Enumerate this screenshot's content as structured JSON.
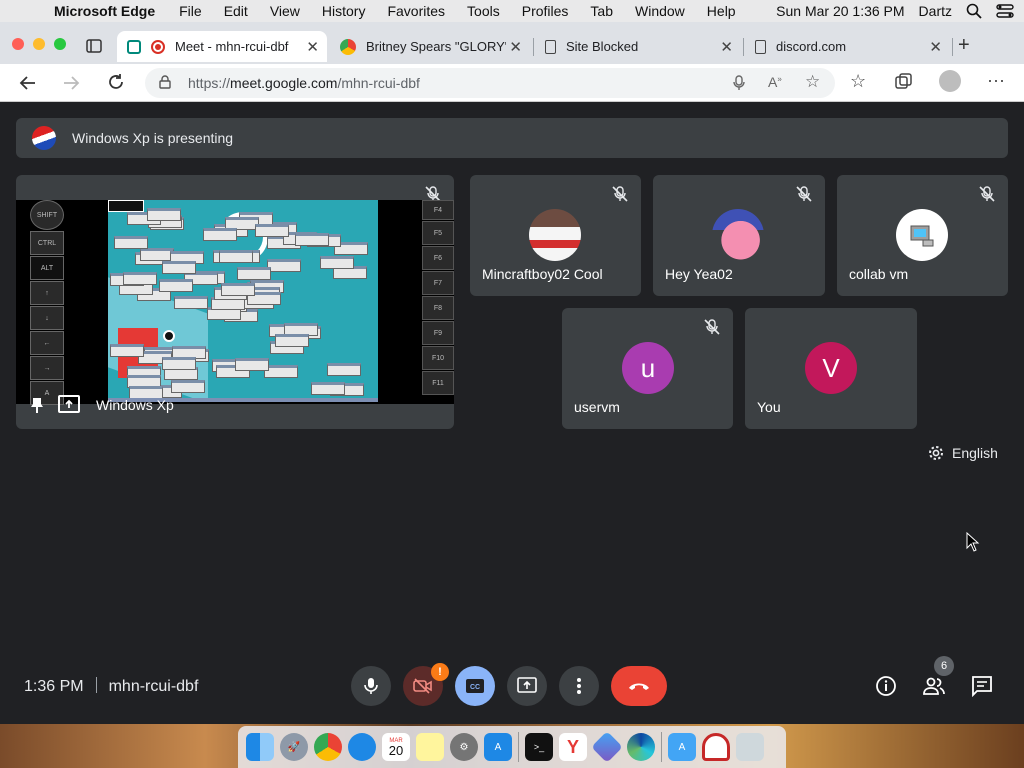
{
  "menubar": {
    "app_name": "Microsoft Edge",
    "menus": [
      "File",
      "Edit",
      "View",
      "History",
      "Favorites",
      "Tools",
      "Profiles",
      "Tab",
      "Window",
      "Help"
    ],
    "datetime": "Sun Mar 20  1:36 PM",
    "user": "Dartz"
  },
  "tabs": [
    {
      "title": "Meet - mhn-rcui-dbf",
      "active": true
    },
    {
      "title": "Britney Spears \"GLORY\"",
      "active": false
    },
    {
      "title": "Site Blocked",
      "active": false
    },
    {
      "title": "discord.com",
      "active": false
    }
  ],
  "address": {
    "url_prefix": "https://",
    "url_host": "meet.google.com",
    "url_path": "/mhn-rcui-dbf"
  },
  "presenting": {
    "text": "Windows Xp is presenting"
  },
  "screen_share": {
    "name": "Windows Xp",
    "left_keys": [
      "SHIFT",
      "CTRL",
      "ALT",
      "↑",
      "↓",
      "←",
      "→",
      "A"
    ],
    "fkeys": [
      "F4",
      "F5",
      "F6",
      "F7",
      "F8",
      "F9",
      "F10",
      "F11"
    ]
  },
  "participants": [
    {
      "name": "Mincraftboy02 Cool",
      "muted": true
    },
    {
      "name": "Hey Yea02",
      "muted": true
    },
    {
      "name": "collab vm",
      "muted": true
    },
    {
      "name": "uservm",
      "initial": "u",
      "color": "#a93cb0",
      "muted": true
    },
    {
      "name": "You",
      "initial": "V",
      "color": "#c2185b",
      "muted": false
    }
  ],
  "caption_language": "English",
  "meeting": {
    "time": "1:36 PM",
    "code": "mhn-rcui-dbf",
    "participant_count": "6",
    "warning_badge": "!"
  },
  "dock": {
    "calendar_month": "MAR",
    "calendar_day": "20"
  },
  "colors": {
    "end_call": "#ea4335",
    "cc_active": "#8ab4f8",
    "camera_off": "#5c2b29",
    "warning": "#fa7b17"
  }
}
